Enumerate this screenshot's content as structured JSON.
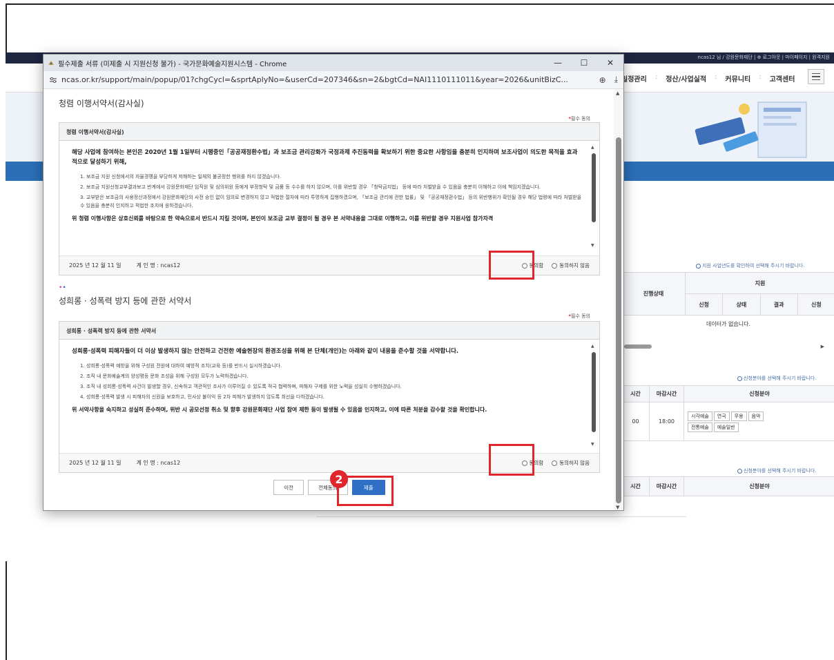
{
  "site": {
    "top_links": "ncas12 님 / 강원문화재단 | ⊕ 로그아웃 | 마이페이지 | 원격지원",
    "menu": [
      "일정관리",
      "정산/사업실적",
      "커뮤니티",
      "고객센터"
    ],
    "menu_seps": [
      ":",
      ":",
      ":"
    ],
    "notice1": "지원 사업년도를 확인하여 선택해 주시기 바랍니다.",
    "table1": {
      "col_status": "진행상태",
      "group": "지원",
      "sub": [
        "신청",
        "상태",
        "결과",
        "신청"
      ],
      "empty": "데이터가 없습니다."
    },
    "notice2": "신청분야를 선택해 주시기 바랍니다.",
    "table2": {
      "head": [
        "시간",
        "마감시간",
        "신청분야"
      ],
      "row": [
        "00",
        "18:00"
      ],
      "fields": [
        "시각예술",
        "연극",
        "무용",
        "음악",
        "전통예술",
        "예술일반"
      ]
    },
    "notice3": "신청분야를 선택해 주시기 바랍니다.",
    "table3": {
      "head": [
        "시간",
        "마감시간",
        "신청분야"
      ]
    }
  },
  "popup": {
    "window_title": "필수제출 서류 (미제출 시 지원신청 불가) - 국가문화예술지원시스템 - Chrome",
    "minimize": "—",
    "maximize": "☐",
    "close": "✕",
    "url": "ncas.or.kr/support/main/popup/01?chgCycl=&sprtAplyNo=&userCd=207346&sn=2&bgtCd=NAI1110111011&year=2026&unitBizC...",
    "zoom_icon": "⊕",
    "download_icon": "⤓",
    "required_mark": "*",
    "required_label": "필수 동의",
    "section1": {
      "title": "청렴 이행서약서(감사실)",
      "card_head": "청렴 이행서약서(감사실)",
      "lead": "해당 사업에 참여하는 본인은 2020년 1월 1일부터 시행중인「공공재정환수법」과 보조금 관리강화가 국정과제 추진동력을 확보하기 위한 중요한 사항임을 충분히 인지하며 보조사업이 의도한 목적을 효과적으로 달성하기 위해,",
      "items": [
        "1. 보조금 지원 신청에서의 자율경쟁을 부당하게 저해하는 일체의 불공정한 행위를 하지 않겠습니다.",
        "2. 보조금 지원신청교부결과보고 반계에서 강원문화재단 임직원 및 심의위원 등에게 부정청탁 및 금품 등 수수를 하지 않으며, 이를 위반할 경우 「청탁금지법」 등에 따라 처벌받을 수 있음을 충분히 이해하고 이에 책임지겠습니다.",
        "3. 교부받은 보조금의 사용정산과정에서 강원문화재단의 사전 승인 없이 임의로 변경하지 않고 적법한 절차에 따라 투명하게 집행하겠으며, 「보조금 관리에 관한 법률」 및 「공공재정환수법」 등의 위반행위가 확인될 경우 해당 법령에 따라 처벌받을 수 있음을 충분히 인지하고 적법한 조치에 응하겠습니다."
      ],
      "tail": "위 청렴 이행사항은 상호신뢰를 바탕으로 한 약속으로서 반드시 지킬 것이며, 본인이 보조금 교부 결정이 될 경우 본 서약내용을 그대로 이행하고, 이를 위반할 경우 지원사업 참가자격",
      "date": "2025 년 12 월 11 일",
      "signer": "계 인 명 : ncas12",
      "agree": "동의함",
      "disagree": "동의하지 않음"
    },
    "section2": {
      "dots": "••",
      "title": "성희롱 · 성폭력 방지 등에 관한 서약서",
      "card_head": "성희롱 · 성폭력 방지 등에 관한 서약서",
      "lead": "성희롱·성폭력 피해자들이 더 이상 발생하지 않는 안전하고 건전한 예술현장의 환경조성을 위해 본 단체(개인)는 아래와 같이 내용을 준수할 것을 서약합니다.",
      "items": [
        "1. 성희롱·성폭력 예방을 위해 구성원 전원에 대하여 예방적 조치(교육 등)를 반드시 실시하겠습니다.",
        "2. 조직 내 문화예술계의 양성평등 문화 조성을 위해 구성원 모두가 노력하겠습니다.",
        "3. 조직 내 성희롱·성폭력 사건이 발생할 경우, 신속하고 객관적인 조사가 이루어질 수 있도록 적극 협력하며, 피해자 구제를 위한 노력을 성실히 수행하겠습니다.",
        "4. 성희롱·성폭력 발생 시 피해자의 신원을 보호하고, 민사상 불이익 등 2차 피해가 발생하지 않도록 최선을 다하겠습니다."
      ],
      "tail": "위 서약사항을 숙지하고 성실히 준수하며, 위반 시 공모선정 취소 및 향후 강원문화재단 사업 참여 제한 등이 발생될 수 있음을 인지하고, 이에 따른 처분을 감수할 것을 확인합니다.",
      "date": "2025 년 12 월 11 일",
      "signer": "계 인 명 : ncas12",
      "agree": "동의함",
      "disagree": "동의하지 않음"
    },
    "buttons": {
      "prev": "이전",
      "all_agree": "전체동의",
      "submit": "제출"
    },
    "step_badge": "2"
  },
  "colors": {
    "highlight": "#e0262c",
    "primary": "#2f6fc4",
    "site_nav_dark": "#1e2640",
    "hero_band": "#2c6fb7"
  }
}
